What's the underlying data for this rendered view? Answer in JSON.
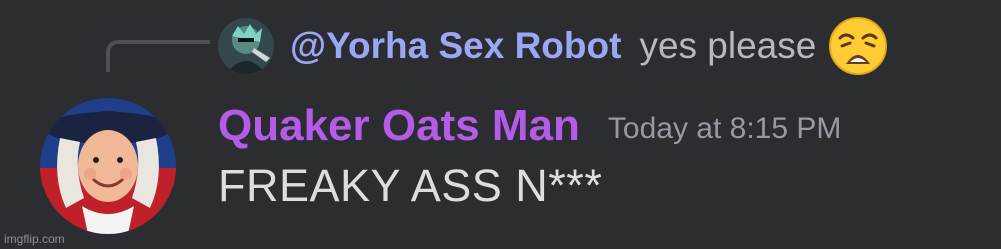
{
  "reply": {
    "author": "@Yorha Sex Robot",
    "content": "yes please",
    "emoji_icon": "weary-face-emoji"
  },
  "message": {
    "author": "Quaker Oats Man",
    "timestamp": "Today at 8:15 PM",
    "content": "FREAKY ASS N***"
  },
  "watermark": "imgflip.com",
  "colors": {
    "background": "#2b2d31",
    "reply_author": "#9aa7f5",
    "author": "#b45ce8",
    "timestamp": "#949ba4",
    "content": "#dbdee1"
  }
}
